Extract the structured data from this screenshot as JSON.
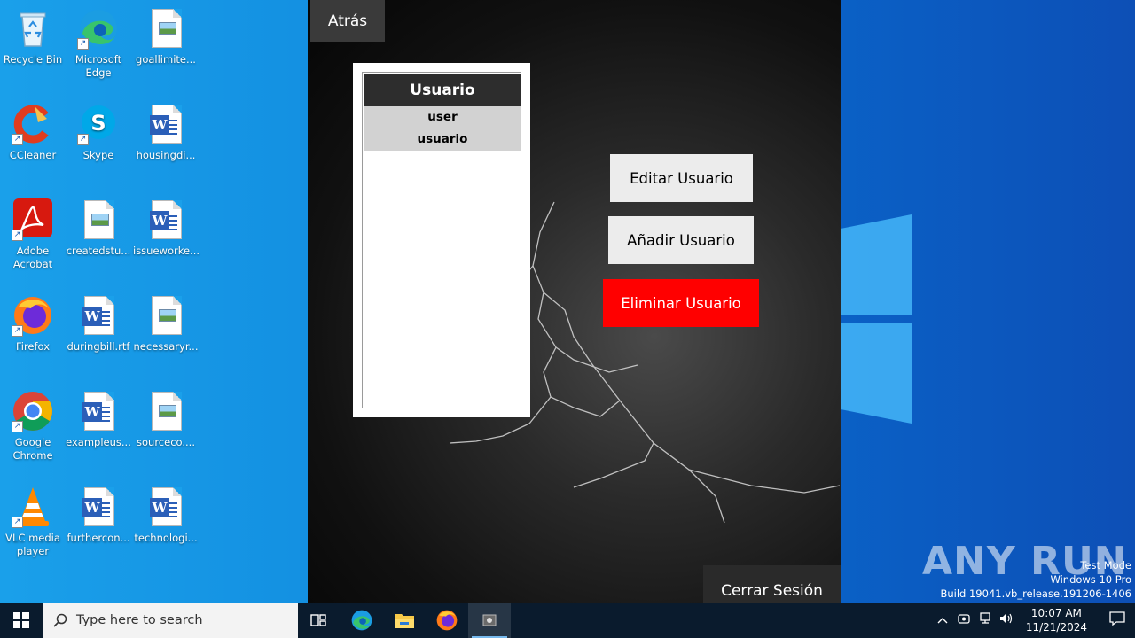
{
  "desktop": {
    "icons": [
      {
        "label": "Recycle Bin",
        "icon": "recycle-bin-icon"
      },
      {
        "label": "Microsoft Edge",
        "icon": "edge-icon"
      },
      {
        "label": "goallimite...",
        "icon": "image-file-icon"
      },
      {
        "label": "CCleaner",
        "icon": "ccleaner-icon"
      },
      {
        "label": "Skype",
        "icon": "skype-icon"
      },
      {
        "label": "housingdi...",
        "icon": "word-file-icon"
      },
      {
        "label": "Adobe Acrobat",
        "icon": "acrobat-icon"
      },
      {
        "label": "createdstu...",
        "icon": "image-file-icon"
      },
      {
        "label": "issueworke...",
        "icon": "word-file-icon"
      },
      {
        "label": "Firefox",
        "icon": "firefox-icon"
      },
      {
        "label": "duringbill.rtf",
        "icon": "word-file-icon"
      },
      {
        "label": "necessaryr...",
        "icon": "image-file-icon"
      },
      {
        "label": "Google Chrome",
        "icon": "chrome-icon"
      },
      {
        "label": "exampleus...",
        "icon": "word-file-icon"
      },
      {
        "label": "sourceco....",
        "icon": "image-file-icon"
      },
      {
        "label": "VLC media player",
        "icon": "vlc-icon"
      },
      {
        "label": "furthercon...",
        "icon": "word-file-icon"
      },
      {
        "label": "technologi...",
        "icon": "word-file-icon"
      }
    ]
  },
  "app": {
    "back_label": "Atrás",
    "list_header": "Usuario",
    "users": [
      "user",
      "usuario"
    ],
    "edit_label": "Editar Usuario",
    "add_label": "Añadir Usuario",
    "delete_label": "Eliminar Usuario",
    "logout_label": "Cerrar Sesión",
    "danger_color": "#ff0000"
  },
  "watermark": {
    "text": "ANY RUN",
    "mode": "Test Mode",
    "edition": "Windows 10 Pro",
    "build": "Build 19041.vb_release.191206-1406"
  },
  "taskbar": {
    "search_placeholder": "Type here to search",
    "time": "10:07 AM",
    "date": "11/21/2024"
  }
}
